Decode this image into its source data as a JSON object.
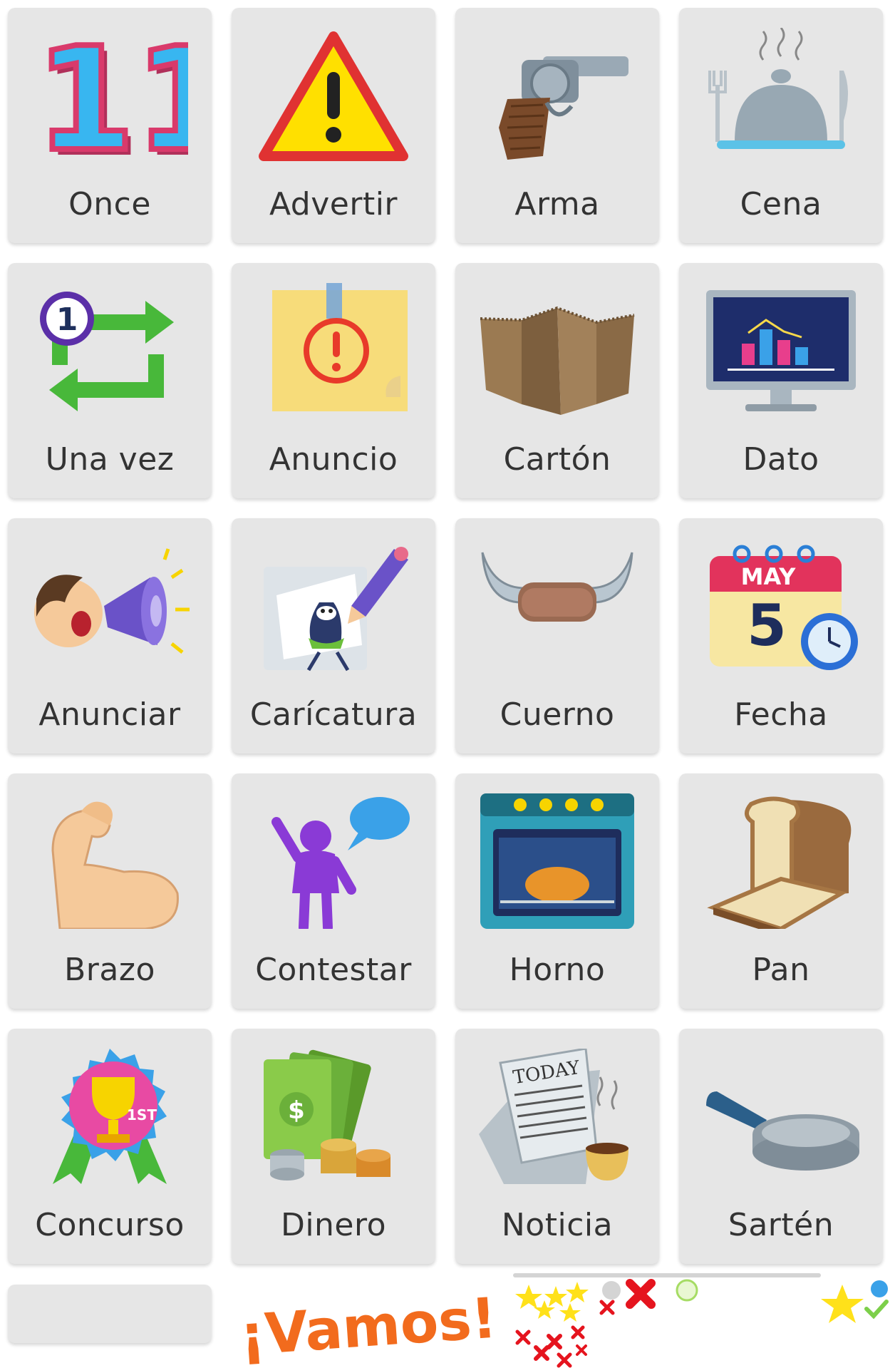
{
  "cards": [
    {
      "label": "Once",
      "icon": "number-eleven-icon"
    },
    {
      "label": "Advertir",
      "icon": "warning-sign-icon"
    },
    {
      "label": "Arma",
      "icon": "revolver-icon"
    },
    {
      "label": "Cena",
      "icon": "dinner-cloche-icon"
    },
    {
      "label": "Una vez",
      "icon": "repeat-once-icon"
    },
    {
      "label": "Anuncio",
      "icon": "notice-note-icon"
    },
    {
      "label": "Cartón",
      "icon": "cardboard-icon"
    },
    {
      "label": "Dato",
      "icon": "data-monitor-icon"
    },
    {
      "label": "Anunciar",
      "icon": "megaphone-icon"
    },
    {
      "label": "Carícatura",
      "icon": "cartoon-drawing-icon"
    },
    {
      "label": "Cuerno",
      "icon": "horns-icon"
    },
    {
      "label": "Fecha",
      "icon": "calendar-date-icon"
    },
    {
      "label": "Brazo",
      "icon": "flexed-arm-icon"
    },
    {
      "label": "Contestar",
      "icon": "answer-speech-icon"
    },
    {
      "label": "Horno",
      "icon": "oven-icon"
    },
    {
      "label": "Pan",
      "icon": "bread-loaf-icon"
    },
    {
      "label": "Concurso",
      "icon": "trophy-ribbon-icon"
    },
    {
      "label": "Dinero",
      "icon": "money-icon"
    },
    {
      "label": "Noticia",
      "icon": "newspaper-icon"
    },
    {
      "label": "Sartén",
      "icon": "frying-pan-icon"
    }
  ],
  "calendar": {
    "month": "MAY",
    "day": "5"
  },
  "newspaper": {
    "masthead": "TODAY"
  },
  "trophy": {
    "place": "1ST"
  },
  "number": {
    "value": "11"
  },
  "repeat": {
    "count": "1"
  },
  "money": {
    "symbol": "$"
  },
  "footer": {
    "logo_text": "¡Vamos!"
  },
  "colors": {
    "card_bg": "#e6e6e6",
    "label": "#333333",
    "logo_orange": "#f26b1d",
    "accent_green": "#55c43a",
    "accent_red": "#e5141e",
    "star_yellow": "#ffe11a"
  }
}
